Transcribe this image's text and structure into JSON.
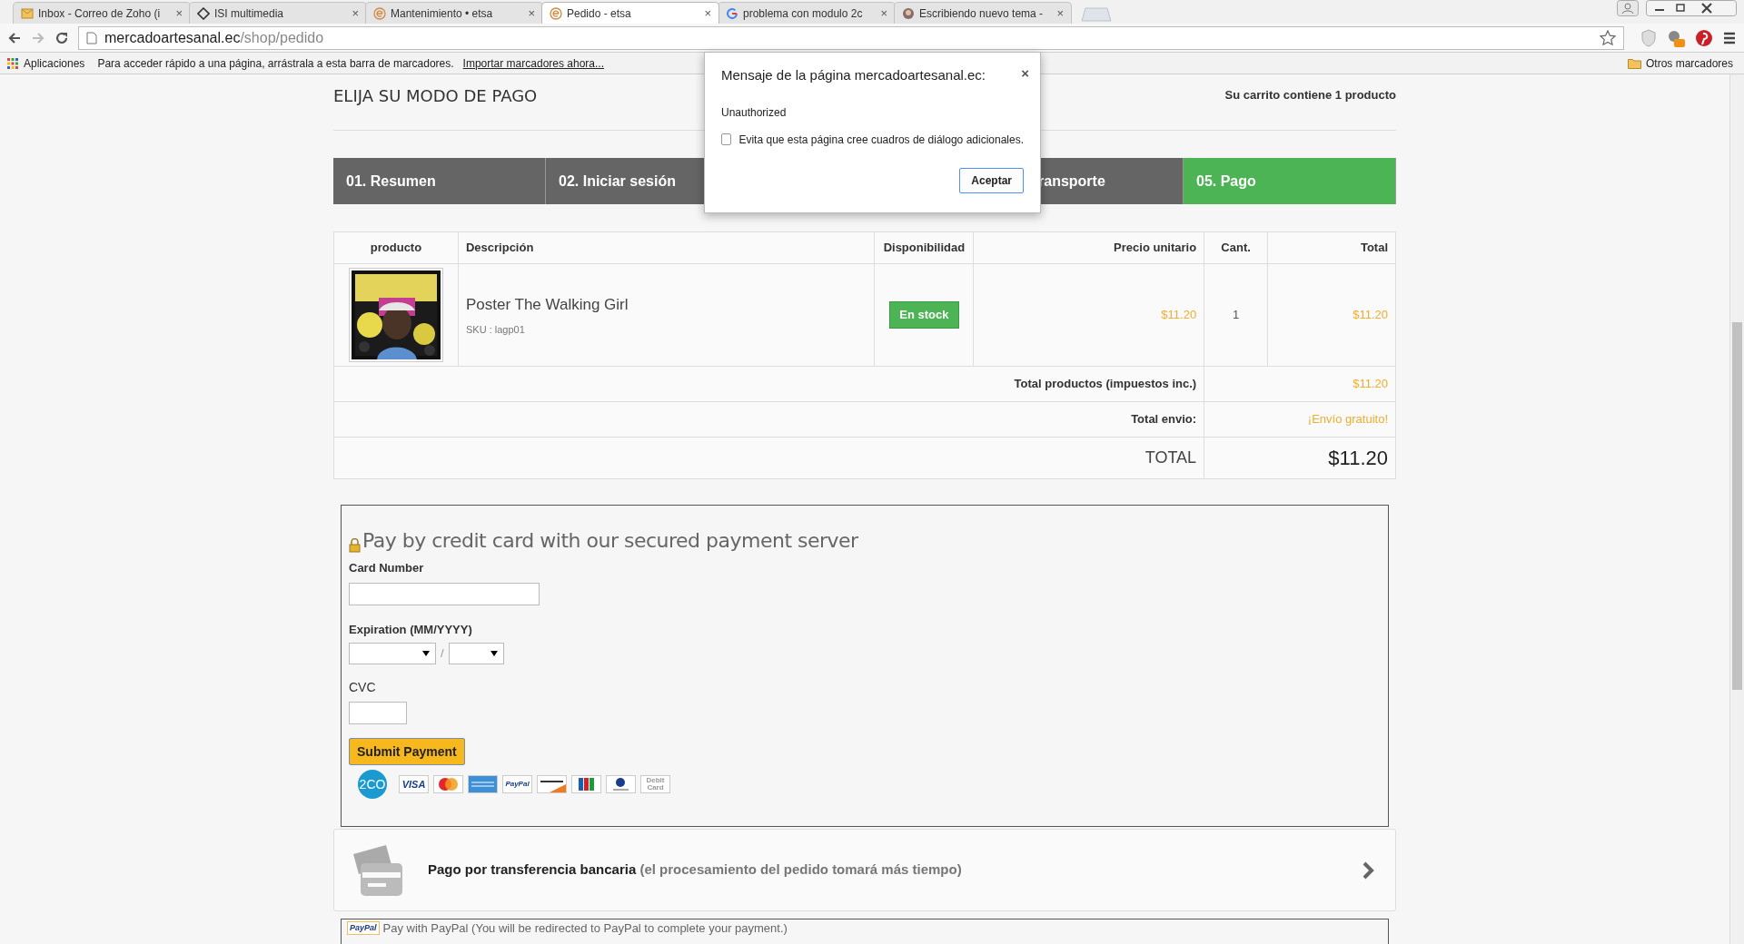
{
  "browser": {
    "tabs": [
      {
        "title": "Inbox - Correo de Zoho (i",
        "close": "×",
        "selected": false
      },
      {
        "title": "ISI multimedia",
        "close": "×",
        "selected": false
      },
      {
        "title": "Mantenimiento • etsa",
        "close": "×",
        "selected": false
      },
      {
        "title": "Pedido - etsa",
        "close": "×",
        "selected": true
      },
      {
        "title": "problema con modulo 2c",
        "close": "×",
        "selected": false
      },
      {
        "title": "Escribiendo nuevo tema -",
        "close": "×",
        "selected": false
      }
    ],
    "address": {
      "host": "mercadoartesanal.ec",
      "path": "/shop/pedido"
    },
    "bookmarks": {
      "apps": "Aplicaciones",
      "hint": "Para acceder rápido a una página, arrástrala a esta barra de marcadores.",
      "import_link": "Importar marcadores ahora...",
      "other": "Otros marcadores"
    }
  },
  "page": {
    "heading": "ELIJA SU MODO DE PAGO",
    "cart_summary": "Su carrito contiene 1 producto",
    "steps": [
      {
        "label": "01. Resumen",
        "selected": false
      },
      {
        "label": "02. Iniciar sesión",
        "selected": false
      },
      {
        "label": "ransporte",
        "selected": false
      },
      {
        "label": "05. Pago",
        "selected": true
      }
    ],
    "table": {
      "columns": [
        "producto",
        "Descripción",
        "Disponibilidad",
        "Precio unitario",
        "Cant.",
        "Total"
      ],
      "rows": [
        {
          "name": "Poster The Walking Girl",
          "sku": "SKU : lagp01",
          "availability": "En stock",
          "unit_price": "$11.20",
          "quantity": "1",
          "total": "$11.20"
        }
      ],
      "summary": [
        {
          "label": "Total productos (impuestos inc.)",
          "value": "$11.20",
          "kind": "subtotal"
        },
        {
          "label": "Total envio:",
          "value": "¡Envío gratuito!",
          "kind": "subtotal"
        },
        {
          "label": "TOTAL",
          "value": "$11.20",
          "kind": "grand"
        }
      ]
    },
    "card_payment": {
      "title": "Pay by credit card with our secured payment server",
      "card_number_label": "Card Number",
      "expiration_label": "Expiration (MM/YYYY)",
      "separator": "/",
      "cvc_label": "CVC",
      "submit": "Submit Payment",
      "logos": [
        {
          "kind": "circle",
          "text": "2CO"
        },
        {
          "kind": "visa",
          "text": "VISA"
        },
        {
          "kind": "mastercard"
        },
        {
          "kind": "amex"
        },
        {
          "kind": "paypal",
          "text": "PayPal"
        },
        {
          "kind": "discover"
        },
        {
          "kind": "jcb"
        },
        {
          "kind": "diners"
        },
        {
          "kind": "plain",
          "text": "Debit Card"
        }
      ]
    },
    "bank_transfer": {
      "title": "Pago por transferencia bancaria",
      "note": "(el procesamiento del pedido tomará más tiempo)"
    },
    "paypal": {
      "logo": "PayPal",
      "text": "Pay with PayPal (You will be redirected to PayPal to complete your payment.)"
    }
  },
  "dialog": {
    "title": "Mensaje de la página mercadoartesanal.ec:",
    "close": "×",
    "message": "Unauthorized",
    "checkbox": {
      "label": "Evita que esta página cree cuadros de diálogo adicionales.",
      "checked": false
    },
    "button": "Aceptar"
  }
}
